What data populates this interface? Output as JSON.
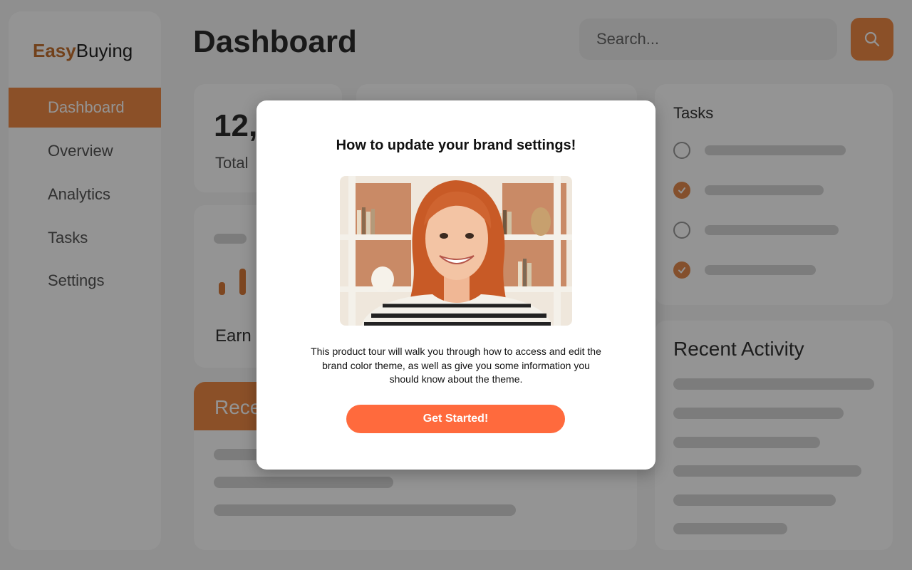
{
  "brand": {
    "logo_part1": "Easy",
    "logo_part2": "Buying"
  },
  "sidebar": {
    "items": [
      {
        "label": "Dashboard",
        "active": true
      },
      {
        "label": "Overview",
        "active": false
      },
      {
        "label": "Analytics",
        "active": false
      },
      {
        "label": "Tasks",
        "active": false
      },
      {
        "label": "Settings",
        "active": false
      }
    ]
  },
  "header": {
    "title": "Dashboard",
    "search_placeholder": "Search...",
    "search_icon": "search-icon"
  },
  "cards": {
    "stat_value": "12,",
    "stat_label": "Total",
    "earnings_label": "Earn",
    "recent_title": "Rece",
    "tasks_title": "Tasks",
    "tasks": [
      {
        "done": false
      },
      {
        "done": true
      },
      {
        "done": false
      },
      {
        "done": true
      }
    ],
    "activity_title": "Recent Activity"
  },
  "modal": {
    "title": "How to update your brand settings!",
    "image_description_icon": "portrait-photo",
    "body": "This product tour will walk you through how to access and edit the brand color theme, as well as give you some information you should know about the theme.",
    "button_label": "Get Started!"
  },
  "colors": {
    "accent": "#f08a46",
    "button": "#ff6a3d",
    "overlay": "rgba(0,0,0,0.42)"
  }
}
